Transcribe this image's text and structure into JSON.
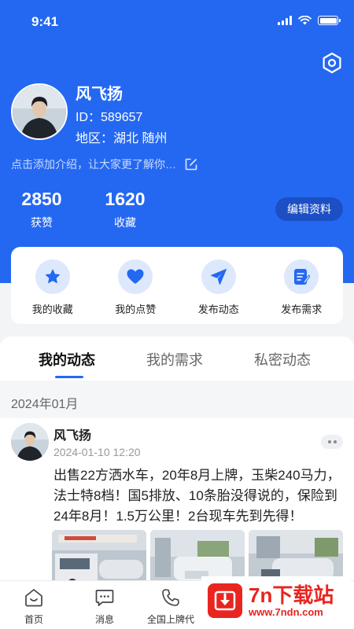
{
  "status_bar": {
    "time": "9:41"
  },
  "colors": {
    "brand": "#2468f2",
    "accent_soft": "#dde8fd",
    "watermark_red": "#e8251f"
  },
  "profile": {
    "name": "风飞扬",
    "id_line": "ID：589657",
    "region_line": "地区：湖北 随州",
    "bio_placeholder": "点击添加介绍，让大家更了解你…",
    "stats": [
      {
        "value": "2850",
        "label": "获赞"
      },
      {
        "value": "1620",
        "label": "收藏"
      }
    ],
    "edit_button": "编辑资料"
  },
  "icons": {
    "settings": "hexagon-gear-icon",
    "edit_bio": "edit-icon",
    "more": "more-dots-icon"
  },
  "quick_actions": [
    {
      "label": "我的收藏",
      "icon": "star-icon"
    },
    {
      "label": "我的点赞",
      "icon": "heart-icon"
    },
    {
      "label": "发布动态",
      "icon": "paper-plane-icon"
    },
    {
      "label": "发布需求",
      "icon": "document-edit-icon"
    }
  ],
  "tabs": [
    {
      "label": "我的动态",
      "active": true
    },
    {
      "label": "我的需求",
      "active": false
    },
    {
      "label": "私密动态",
      "active": false
    }
  ],
  "feed": {
    "month_header": "2024年01月",
    "post": {
      "author": "风飞扬",
      "time": "2024-01-10 12:20",
      "text": "出售22方洒水车，20年8月上牌，玉柴240马力，法士特8档！国5排放、10条胎没得说的，保险到24年8月！1.5万公里！2台现车先到先得！",
      "image_count": 3
    }
  },
  "bottom_nav": [
    {
      "label": "首页",
      "icon": "home-icon"
    },
    {
      "label": "消息",
      "icon": "message-icon"
    },
    {
      "label": "全国上牌代",
      "icon": "phone-icon"
    }
  ],
  "watermark": {
    "title": "7n下载站",
    "url": "www.7ndn.com"
  }
}
